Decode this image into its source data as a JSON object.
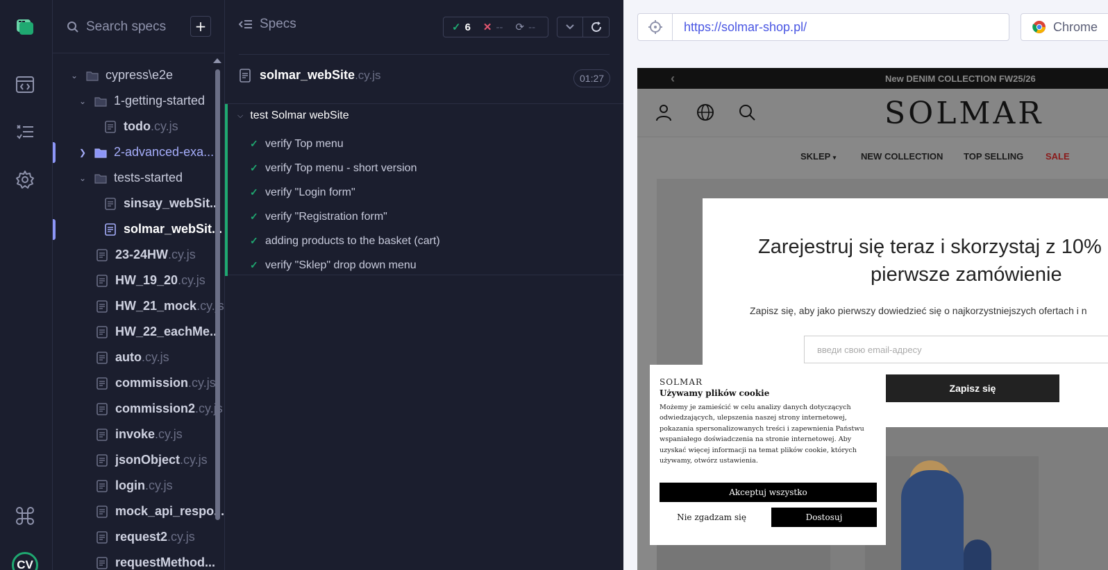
{
  "sidebar": {
    "search_placeholder": "Search specs",
    "add_label": "+",
    "tree": [
      {
        "name": "cypress\\e2e",
        "ext": "",
        "kind": "folder"
      },
      {
        "name": "1-getting-started",
        "ext": "",
        "kind": "folder"
      },
      {
        "name": "todo",
        "ext": ".cy.js",
        "kind": "file"
      },
      {
        "name": "2-advanced-exa...",
        "ext": "",
        "kind": "folder"
      },
      {
        "name": "tests-started",
        "ext": "",
        "kind": "folder"
      },
      {
        "name": "sinsay_webSit...",
        "ext": "",
        "kind": "file"
      },
      {
        "name": "solmar_webSit...",
        "ext": "",
        "kind": "file"
      },
      {
        "name": "23-24HW",
        "ext": ".cy.js",
        "kind": "file"
      },
      {
        "name": "HW_19_20",
        "ext": ".cy.js",
        "kind": "file"
      },
      {
        "name": "HW_21_mock",
        "ext": ".cy.js",
        "kind": "file"
      },
      {
        "name": "HW_22_eachMe...",
        "ext": "",
        "kind": "file"
      },
      {
        "name": "auto",
        "ext": ".cy.js",
        "kind": "file"
      },
      {
        "name": "commission",
        "ext": ".cy.js",
        "kind": "file"
      },
      {
        "name": "commission2",
        "ext": ".cy.js",
        "kind": "file"
      },
      {
        "name": "invoke",
        "ext": ".cy.js",
        "kind": "file"
      },
      {
        "name": "jsonObject",
        "ext": ".cy.js",
        "kind": "file"
      },
      {
        "name": "login",
        "ext": ".cy.js",
        "kind": "file"
      },
      {
        "name": "mock_api_respo...",
        "ext": "",
        "kind": "file"
      },
      {
        "name": "request2",
        "ext": ".cy.js",
        "kind": "file"
      },
      {
        "name": "requestMethod...",
        "ext": "",
        "kind": "file"
      }
    ]
  },
  "rail": {
    "cv_label": "CV"
  },
  "reporter": {
    "specs_label": "Specs",
    "passed": "6",
    "failed": "--",
    "pending": "--",
    "spec_name": "solmar_webSite",
    "spec_ext": ".cy.js",
    "duration": "01:27",
    "suite_title": "test Solmar webSite",
    "tests": [
      "verify Top menu",
      "verify Top menu - short version",
      "verify \"Login form\"",
      "verify \"Registration form\"",
      "adding products to the basket (cart)",
      "verify \"Sklep\" drop down menu"
    ]
  },
  "browser": {
    "url": "https://solmar-shop.pl/",
    "browser_name": "Chrome"
  },
  "site": {
    "promo": "New DENIM COLLECTION FW25/26",
    "brand": "SOLMAR",
    "menu": [
      "SKLEP",
      "NEW COLLECTION",
      "TOP SELLING",
      "SALE"
    ],
    "modal": {
      "heading_line1": "Zarejestruj się teraz i skorzystaj z 10%",
      "heading_line2": "pierwsze zamówienie",
      "subtext": "Zapisz się, aby jako pierwszy dowiedzieć się o najkorzystniejszych ofertach i n",
      "email_placeholder": "введи свою email-адресу",
      "submit_label": "Zapisz się"
    },
    "cookie": {
      "brand": "SOLMAR",
      "title": "Używamy plików cookie",
      "text": "Możemy je zamieścić w celu analizy danych dotyczących odwiedzających, ulepszenia naszej strony internetowej, pokazania spersonalizowanych treści i zapewnienia Państwu wspaniałego doświadczenia na stronie internetowej. Aby uzyskać więcej informacji na temat plików cookie, których używamy, otwórz ustawienia.",
      "accept_label": "Akceptuj wszystko",
      "reject_label": "Nie zgadzam się",
      "customize_label": "Dostosuj"
    }
  },
  "colors": {
    "bg": "#1b1e2e",
    "pass": "#1fa971",
    "fail": "#e45770",
    "accent": "#8d96f7",
    "url": "#4956e3"
  }
}
